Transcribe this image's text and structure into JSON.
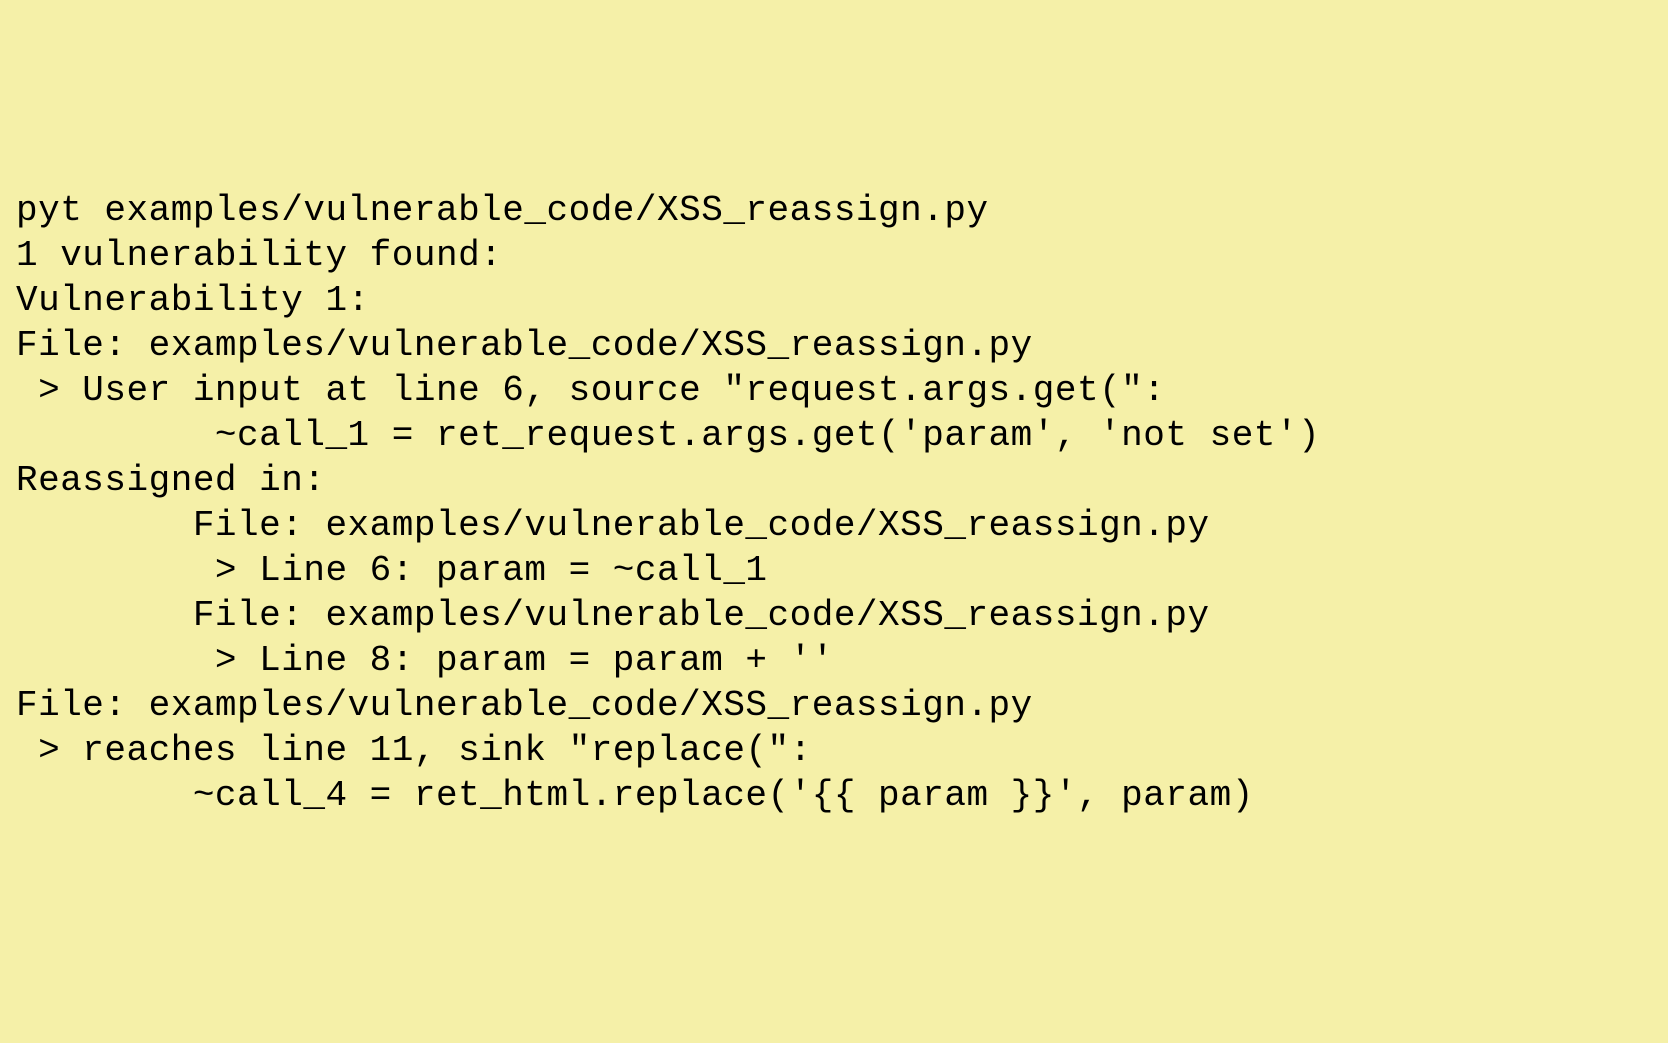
{
  "terminal_output": {
    "line1": "pyt examples/vulnerable_code/XSS_reassign.py",
    "line2": "1 vulnerability found:",
    "line3": "Vulnerability 1:",
    "line4": "File: examples/vulnerable_code/XSS_reassign.py",
    "line5": " > User input at line 6, source \"request.args.get(\":",
    "line6": "         ~call_1 = ret_request.args.get('param', 'not set')",
    "line7": "Reassigned in:",
    "line8": "        File: examples/vulnerable_code/XSS_reassign.py",
    "line9": "         > Line 6: param = ~call_1",
    "line10": "        File: examples/vulnerable_code/XSS_reassign.py",
    "line11": "         > Line 8: param = param + ''",
    "line12": "File: examples/vulnerable_code/XSS_reassign.py",
    "line13": " > reaches line 11, sink \"replace(\":",
    "line14": "        ~call_4 = ret_html.replace('{{ param }}', param)"
  }
}
